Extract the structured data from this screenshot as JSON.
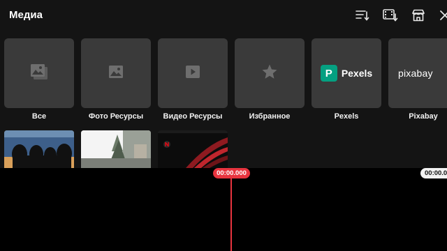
{
  "header": {
    "title": "Медиа",
    "icons": [
      "sort-icon",
      "video-download-icon",
      "store-icon",
      "close-icon"
    ]
  },
  "categories": [
    {
      "label": "Все",
      "icon": "gallery-stack-icon"
    },
    {
      "label": "Фото Ресурсы",
      "icon": "image-icon"
    },
    {
      "label": "Видео Ресурсы",
      "icon": "play-icon"
    },
    {
      "label": "Избранное",
      "icon": "star-icon"
    },
    {
      "label": "Pexels",
      "logo_mark": "P",
      "logo_text": "Pexels",
      "brand_color": "#05a081"
    },
    {
      "label": "Pixabay",
      "logo_text": "pixabay"
    }
  ],
  "thumbnails": [
    {
      "kind": "image"
    },
    {
      "kind": "image"
    },
    {
      "kind": "video"
    }
  ],
  "timeline": {
    "current_time": "00:00.000",
    "end_time": "00:00.0",
    "accent_color": "#e8343f"
  }
}
